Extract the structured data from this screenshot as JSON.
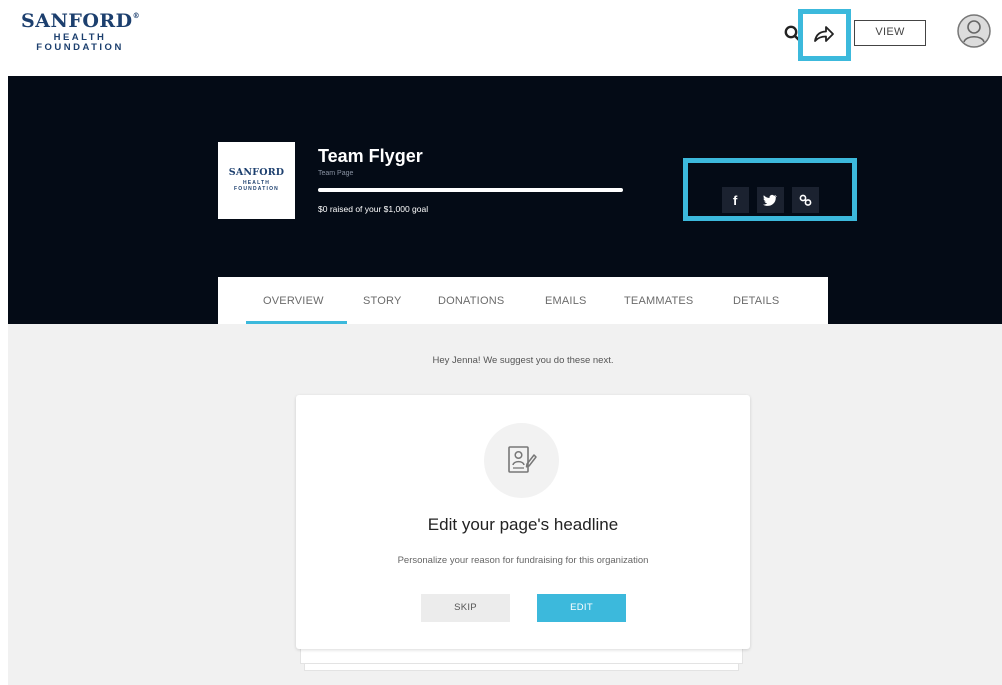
{
  "header": {
    "logo": {
      "line1": "SANFORD",
      "line2": "HEALTH",
      "line3": "FOUNDATION"
    },
    "search_icon": "search-icon",
    "share_icon": "share-arrow-icon",
    "view_label": "VIEW",
    "avatar_icon": "user-avatar-icon"
  },
  "team": {
    "logo": {
      "line1": "SANFORD",
      "line2": "HEALTH",
      "line3": "FOUNDATION"
    },
    "name": "Team Flyger",
    "subtitle": "Team Page",
    "progress_fraction": 0,
    "raised_text": "$0 raised of your $1,000 goal",
    "social": [
      {
        "label": "f",
        "icon": "facebook-icon"
      },
      {
        "label": "twitter",
        "icon": "twitter-icon"
      },
      {
        "label": "link",
        "icon": "link-icon"
      }
    ]
  },
  "tabs": [
    {
      "label": "OVERVIEW",
      "active": true
    },
    {
      "label": "STORY",
      "active": false
    },
    {
      "label": "DONATIONS",
      "active": false
    },
    {
      "label": "EMAILS",
      "active": false
    },
    {
      "label": "TEAMMATES",
      "active": false
    },
    {
      "label": "DETAILS",
      "active": false
    }
  ],
  "main": {
    "suggestion": "Hey Jenna! We suggest you do these next.",
    "card": {
      "icon": "edit-profile-icon",
      "title": "Edit your page's headline",
      "description": "Personalize your reason for fundraising for this organization",
      "skip_label": "SKIP",
      "edit_label": "EDIT"
    }
  },
  "colors": {
    "accent": "#3cb9dc",
    "hero_bg": "#040b16",
    "brand_blue": "#1c3f6e",
    "content_bg": "#f1f1f1"
  }
}
